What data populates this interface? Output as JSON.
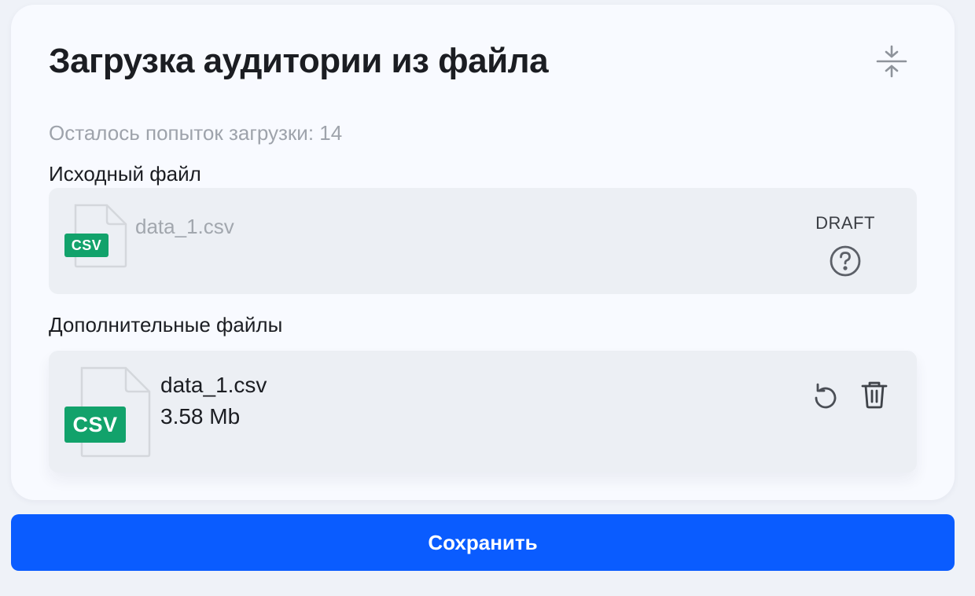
{
  "dialog": {
    "title": "Загрузка аудитории из файла",
    "collapse_icon": "collapse-vertical-icon",
    "attempts_text": "Осталось попыток загрузки: 14"
  },
  "source_section": {
    "label": "Исходный файл",
    "file": {
      "badge": "CSV",
      "name": "data_1.csv",
      "status": "DRAFT",
      "help_icon": "question-circle-icon"
    }
  },
  "extra_section": {
    "label": "Дополнительные файлы",
    "files": [
      {
        "badge": "CSV",
        "name": "data_1.csv",
        "size": "3.58 Mb",
        "actions": [
          "rotate-ccw-icon",
          "trash-icon"
        ]
      }
    ]
  },
  "footer": {
    "save_label": "Сохранить"
  },
  "colors": {
    "accent": "#0a5cff",
    "csv_badge": "#12a26b",
    "muted_text": "#9ea3ab",
    "card_bg": "#f8faff",
    "box_bg": "#eceff4"
  }
}
